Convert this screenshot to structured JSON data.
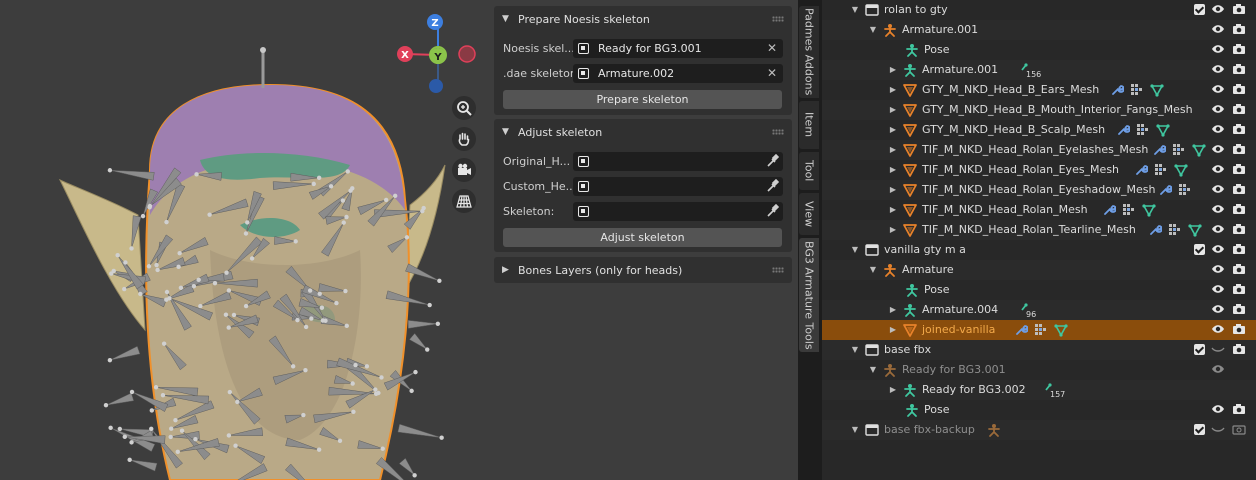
{
  "gizmo": {
    "z": "Z",
    "y": "Y",
    "x": "X"
  },
  "prepare_panel": {
    "title": "Prepare Noesis skeleton",
    "noesis_label": "Noesis skel...",
    "noesis_value": "Ready for BG3.001",
    "dae_label": ".dae skeleton:",
    "dae_value": "Armature.002",
    "button": "Prepare skeleton"
  },
  "adjust_panel": {
    "title": "Adjust skeleton",
    "original_label": "Original_H...",
    "custom_label": "Custom_He...",
    "skeleton_label": "Skeleton:",
    "button": "Adjust skeleton"
  },
  "bones_panel": {
    "title": "Bones Layers (only for heads)"
  },
  "tabs": [
    "Padmes Addons",
    "Item",
    "Tool",
    "View",
    "BG3 Armature Tools"
  ],
  "outliner": {
    "rows": [
      {
        "label": "rolan to gty"
      },
      {
        "label": "Armature.001"
      },
      {
        "label": "Pose"
      },
      {
        "label": "Armature.001",
        "badge": "156"
      },
      {
        "label": "GTY_M_NKD_Head_B_Ears_Mesh"
      },
      {
        "label": "GTY_M_NKD_Head_B_Mouth_Interior_Fangs_Mesh"
      },
      {
        "label": "GTY_M_NKD_Head_B_Scalp_Mesh"
      },
      {
        "label": "TIF_M_NKD_Head_Rolan_Eyelashes_Mesh"
      },
      {
        "label": "TIF_M_NKD_Head_Rolan_Eyes_Mesh"
      },
      {
        "label": "TIF_M_NKD_Head_Rolan_Eyeshadow_Mesh"
      },
      {
        "label": "TIF_M_NKD_Head_Rolan_Mesh"
      },
      {
        "label": "TIF_M_NKD_Head_Rolan_Tearline_Mesh"
      },
      {
        "label": "vanilla gty m a"
      },
      {
        "label": "Armature"
      },
      {
        "label": "Pose"
      },
      {
        "label": "Armature.004",
        "badge": "96"
      },
      {
        "label": "joined-vanilla"
      },
      {
        "label": "base fbx"
      },
      {
        "label": "Ready for BG3.001"
      },
      {
        "label": "Ready for BG3.002",
        "badge": "157"
      },
      {
        "label": "Pose"
      },
      {
        "label": "base fbx-backup"
      }
    ]
  },
  "colors": {
    "accent_selected": "#8a4d0c",
    "mesh_orange": "#e8822a",
    "armature_green": "#3fc7a0",
    "modifier_blue": "#6e9ee6",
    "selection_outline": "#f0902a"
  }
}
